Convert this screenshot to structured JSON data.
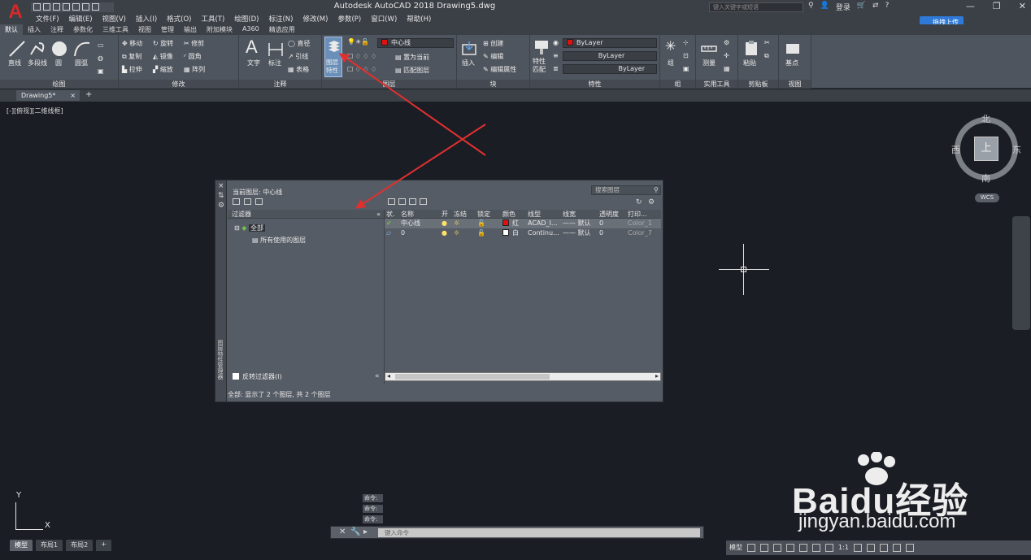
{
  "window": {
    "title": "Autodesk AutoCAD 2018    Drawing5.dwg",
    "search_placeholder": "键入关键字或短语",
    "login": "登录",
    "upload_button": "拖拽上传"
  },
  "menu": [
    "文件(F)",
    "编辑(E)",
    "视图(V)",
    "插入(I)",
    "格式(O)",
    "工具(T)",
    "绘图(D)",
    "标注(N)",
    "修改(M)",
    "参数(P)",
    "窗口(W)",
    "帮助(H)"
  ],
  "ribbon_tabs": [
    "默认",
    "插入",
    "注释",
    "参数化",
    "三维工具",
    "视图",
    "管理",
    "输出",
    "附加模块",
    "A360",
    "精选应用"
  ],
  "ribbon": {
    "draw": {
      "title": "绘图",
      "tools": [
        "直线",
        "多段线",
        "圆",
        "圆弧"
      ]
    },
    "modify": {
      "title": "修改",
      "tools": [
        "移动",
        "旋转",
        "修剪",
        "复制",
        "镜像",
        "圆角",
        "拉伸",
        "缩放",
        "阵列"
      ]
    },
    "annotation": {
      "title": "注释",
      "tools": [
        "文字",
        "标注",
        "直径",
        "引线",
        "表格"
      ]
    },
    "layers": {
      "title": "图层",
      "big_button": "图层特性",
      "current_layer": "中心线",
      "tools": [
        "置为当前",
        "匹配图层"
      ]
    },
    "block": {
      "title": "块",
      "tools": [
        "插入",
        "创建",
        "编辑",
        "编辑属性"
      ]
    },
    "properties": {
      "title": "特性",
      "tools": [
        "特性匹配"
      ],
      "color": "ByLayer",
      "linetype": "ByLayer",
      "lineweight": "ByLayer"
    },
    "groups": {
      "title": "组",
      "tools": [
        "组"
      ]
    },
    "utilities": {
      "title": "实用工具",
      "tools": [
        "测量"
      ]
    },
    "clipboard": {
      "title": "剪贴板",
      "tools": [
        "粘贴"
      ]
    },
    "view": {
      "title": "视图",
      "tools": [
        "基点"
      ]
    }
  },
  "file_tab": "Drawing5*",
  "viewport_label": "[-][俯视][二维线框]",
  "viewcube": {
    "north": "北",
    "south": "南",
    "east": "东",
    "west": "西",
    "top": "上",
    "wcs": "WCS"
  },
  "layer_dialog": {
    "current_layer": "当前图层: 中心线",
    "search_placeholder": "搜索图层",
    "filter_header": "过滤器",
    "filter_all": "全部",
    "filter_used": "所有使用的图层",
    "invert_filter": "反转过滤器(I)",
    "side_title": "图层特性管理器",
    "columns": [
      "状.",
      "名称",
      "开",
      "冻结",
      "锁定",
      "颜色",
      "线型",
      "线宽",
      "透明度",
      "打印..."
    ],
    "rows": [
      {
        "status": "✔",
        "name": "中心线",
        "on": "●",
        "freeze": "☼",
        "lock": "🔓",
        "color": "红",
        "linetype": "ACAD_I...",
        "lineweight": "—— 默认",
        "transparency": "0",
        "plot": "Color_1",
        "swatch": "#e01010"
      },
      {
        "status": "▱",
        "name": "0",
        "on": "●",
        "freeze": "☼",
        "lock": "🔓",
        "color": "白",
        "linetype": "Continu...",
        "lineweight": "—— 默认",
        "transparency": "0",
        "plot": "Color_7",
        "swatch": "#ffffff"
      }
    ],
    "status_text": "全部: 显示了 2 个图层, 共 2 个图层"
  },
  "command": {
    "history": [
      "命令:",
      "命令:",
      "命令:"
    ],
    "placeholder": "键入命令"
  },
  "layout_tabs": [
    "模型",
    "布局1",
    "布局2",
    "+"
  ],
  "statusbar": {
    "model": "模型",
    "scale": "1:1"
  },
  "watermark": {
    "brand": "Baidu经验",
    "url": "jingyan.baidu.com"
  },
  "colors": {
    "accent": "#2f7ad8",
    "arrow": "#e03030",
    "canvas": "#1a1d24"
  }
}
